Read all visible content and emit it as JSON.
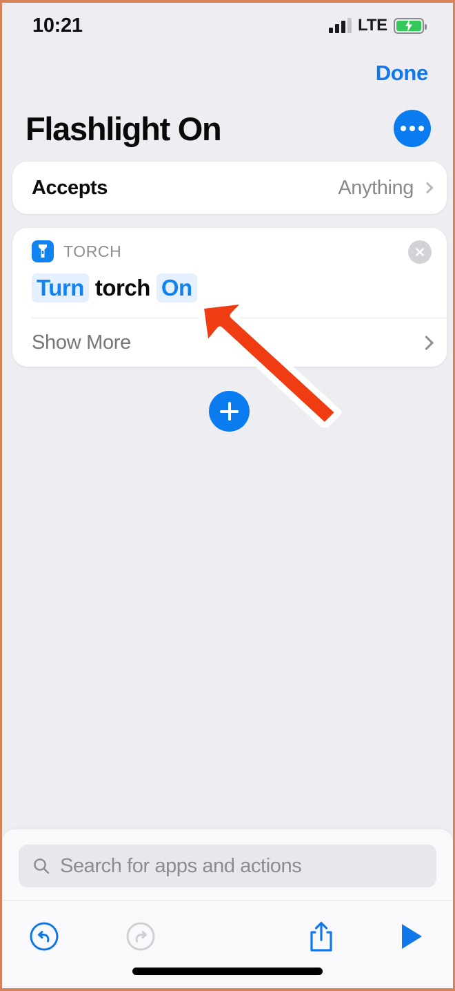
{
  "status_bar": {
    "time": "10:21",
    "carrier_network": "LTE",
    "signal_icon": "cellular-bars-icon",
    "battery_icon": "battery-charging-icon",
    "battery_charging": true
  },
  "nav": {
    "done_label": "Done"
  },
  "header": {
    "title": "Flashlight On",
    "more_icon": "ellipsis-icon"
  },
  "accepts_row": {
    "label": "Accepts",
    "value": "Anything",
    "chevron_icon": "chevron-right-icon"
  },
  "action": {
    "app_name": "TORCH",
    "app_icon": "flashlight-icon",
    "close_icon": "close-circle-icon",
    "phrase": [
      {
        "text": "Turn",
        "type": "variable"
      },
      {
        "text": "torch",
        "type": "plain"
      },
      {
        "text": "On",
        "type": "variable"
      }
    ],
    "show_more_label": "Show More",
    "show_more_chevron_icon": "chevron-right-icon"
  },
  "add_action": {
    "icon": "plus-icon"
  },
  "annotation": {
    "arrow_icon": "arrow-up-left-icon",
    "arrow_color": "#f03c13",
    "arrow_outline_color": "#ffffff"
  },
  "search": {
    "placeholder": "Search for apps and actions",
    "value": "",
    "icon": "search-icon"
  },
  "toolbar": {
    "undo_icon": "undo-icon",
    "redo_icon": "redo-icon",
    "share_icon": "share-icon",
    "run_icon": "play-icon"
  },
  "colors": {
    "accent_blue": "#0a7cf0",
    "page_background": "#eeedf2",
    "card_background": "#ffffff",
    "token_background": "#e4f0fd",
    "disabled_gray": "#c8c8cd",
    "annotation_red": "#f03c13"
  }
}
